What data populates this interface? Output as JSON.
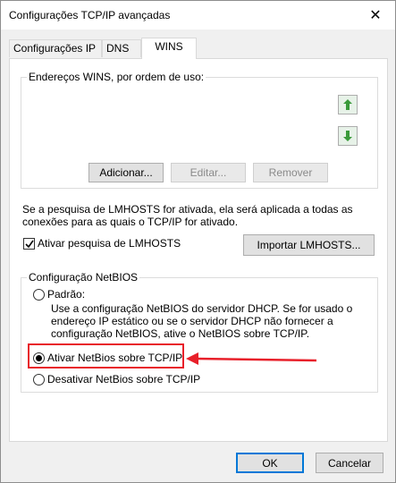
{
  "window": {
    "title": "Configurações TCP/IP avançadas",
    "close_symbol": "✕"
  },
  "tabs": [
    {
      "label": "Configurações IP"
    },
    {
      "label": "DNS"
    },
    {
      "label": "WINS"
    }
  ],
  "wins": {
    "group_title": "Endereços WINS, por ordem de uso:",
    "up_icon": "arrow-up-icon",
    "down_icon": "arrow-down-icon",
    "add_label": "Adicionar...",
    "edit_label": "Editar...",
    "remove_label": "Remover"
  },
  "lmhosts": {
    "description_line1": "Se a pesquisa de LMHOSTS for ativada, ela será aplicada a todas as",
    "description_line2": "conexões para as quais o TCP/IP for ativado.",
    "enable_label": "Ativar pesquisa de LMHOSTS",
    "enable_checked": true,
    "import_label": "Importar LMHOSTS..."
  },
  "netbios": {
    "group_title": "Configuração NetBIOS",
    "default_label": "Padrão:",
    "default_desc_line1": "Use a configuração NetBIOS do servidor DHCP. Se for usado o",
    "default_desc_line2": "endereço IP estático ou se o servidor DHCP não fornecer a",
    "default_desc_line3": "configuração NetBIOS, ative o NetBIOS sobre TCP/IP.",
    "enable_label": "Ativar NetBios sobre TCP/IP",
    "disable_label": "Desativar NetBios sobre TCP/IP",
    "selected": "enable"
  },
  "footer": {
    "ok_label": "OK",
    "cancel_label": "Cancelar"
  },
  "colors": {
    "highlight": "#e8202a",
    "arrow_green": "#3a9a3a",
    "focus_blue": "#0078d7"
  }
}
